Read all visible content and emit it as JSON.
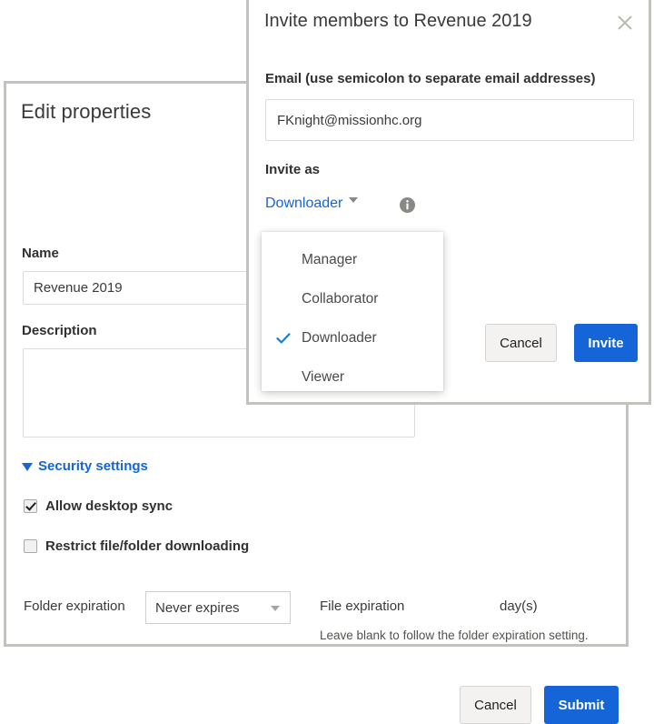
{
  "edit_dialog": {
    "title": "Edit properties",
    "name_label": "Name",
    "name_value": "Revenue 2019",
    "name_placeholder": "",
    "description_label": "Description",
    "description_value": "",
    "description_placeholder": "",
    "security_settings_label": "Security settings",
    "security_expanded": true,
    "checkboxes": [
      {
        "label": "Allow desktop sync",
        "checked": true
      },
      {
        "label": "Restrict file/folder downloading",
        "checked": false
      }
    ],
    "folder_expiration_label": "Folder expiration",
    "folder_expiration_value": "Never expires",
    "folder_expiration_options": [
      "Never expires"
    ],
    "file_expiration_label": "File expiration",
    "file_expiration_value": "",
    "file_expiration_placeholder": "",
    "file_expiration_unit": "day(s)",
    "file_expiration_hint": "Leave blank to follow the folder expiration setting.",
    "cancel_label": "Cancel",
    "submit_label": "Submit"
  },
  "invite_dialog": {
    "title": "Invite members to Revenue 2019",
    "close_icon": "close-icon",
    "email_label": "Email (use semicolon to separate email addresses)",
    "email_value": "FKnight@missionhc.org",
    "email_placeholder": "",
    "invite_as_label": "Invite as",
    "selected_role": "Downloader",
    "info_icon": "info-icon",
    "cancel_label": "Cancel",
    "invite_label": "Invite"
  },
  "role_menu": {
    "options": [
      {
        "label": "Manager",
        "selected": false
      },
      {
        "label": "Collaborator",
        "selected": false
      },
      {
        "label": "Downloader",
        "selected": true
      },
      {
        "label": "Viewer",
        "selected": false
      }
    ]
  },
  "colors": {
    "primary": "#1565d8",
    "link": "#1565d8",
    "dialog_border": "#c4c2be",
    "text": "#323130",
    "muted": "#8a8886"
  }
}
